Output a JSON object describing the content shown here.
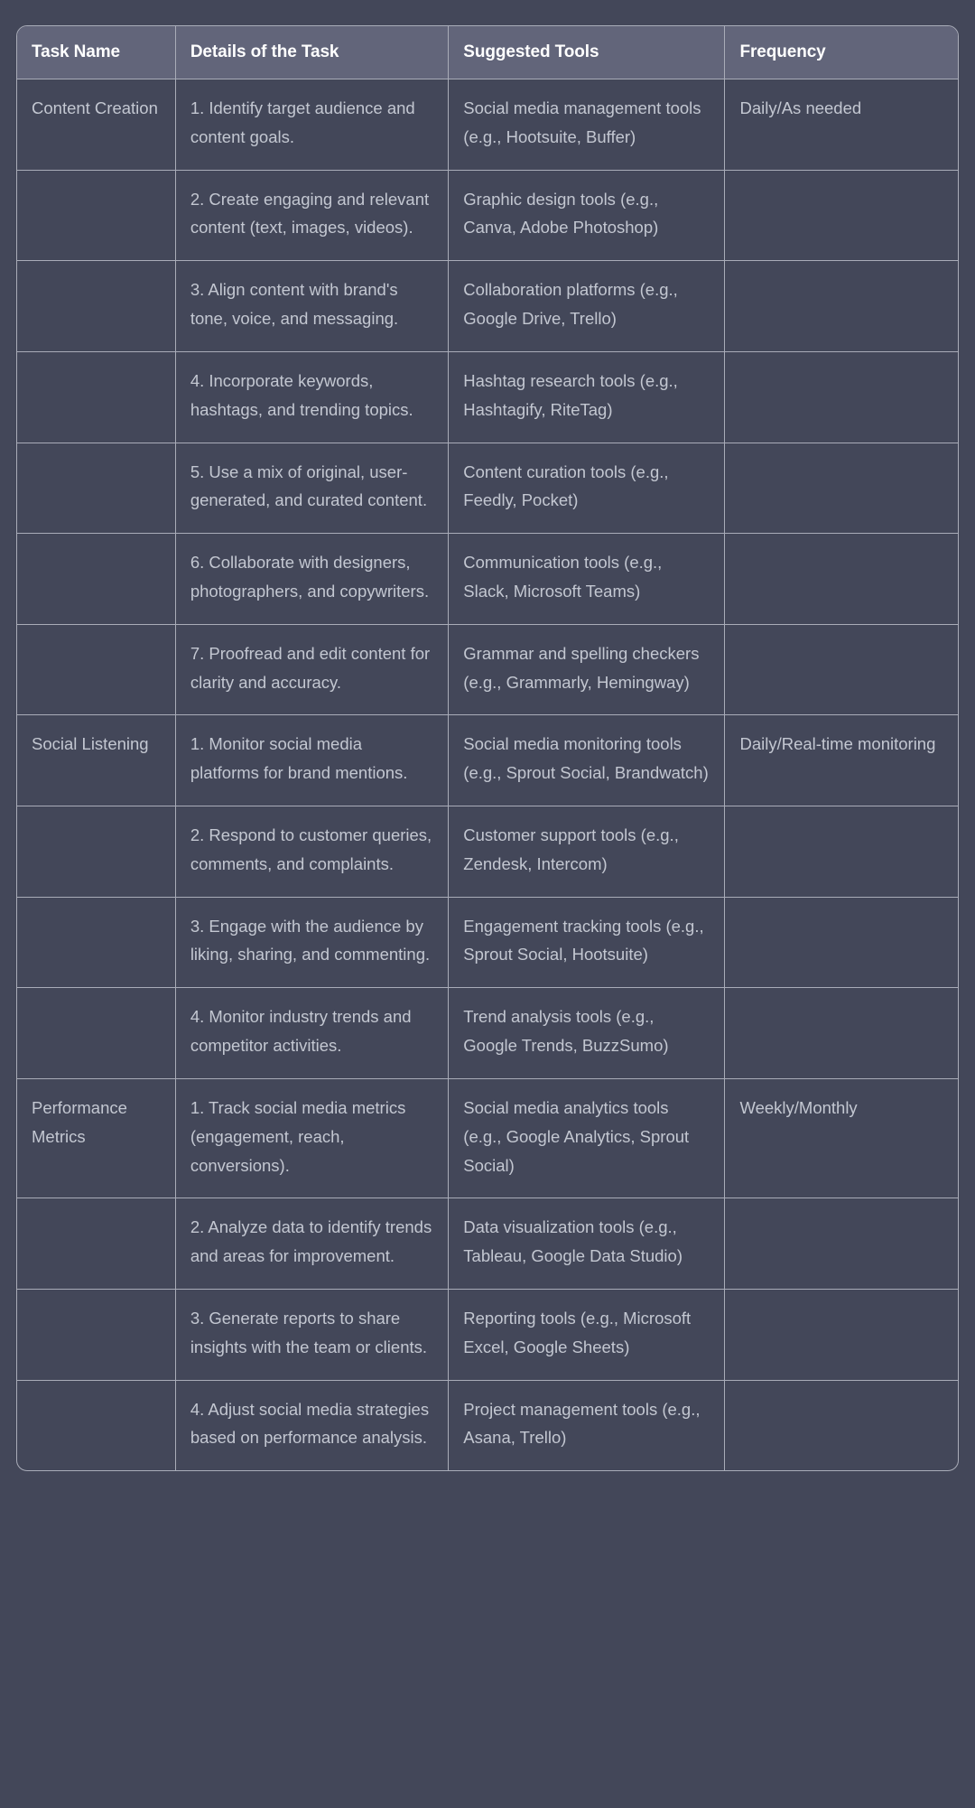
{
  "table": {
    "columns": [
      {
        "key": "task",
        "label": "Task Name"
      },
      {
        "key": "details",
        "label": "Details of the Task"
      },
      {
        "key": "tools",
        "label": "Suggested Tools"
      },
      {
        "key": "frequency",
        "label": "Frequency"
      }
    ],
    "rows": [
      {
        "task": "Content Creation",
        "details": "1. Identify target audience and content goals.",
        "tools": "Social media management tools (e.g., Hootsuite, Buffer)",
        "frequency": "Daily/As needed"
      },
      {
        "task": "",
        "details": "2. Create engaging and relevant content (text, images, videos).",
        "tools": "Graphic design tools (e.g., Canva, Adobe Photoshop)",
        "frequency": ""
      },
      {
        "task": "",
        "details": "3. Align content with brand's tone, voice, and messaging.",
        "tools": "Collaboration platforms (e.g., Google Drive, Trello)",
        "frequency": ""
      },
      {
        "task": "",
        "details": "4. Incorporate keywords, hashtags, and trending topics.",
        "tools": "Hashtag research tools (e.g., Hashtagify, RiteTag)",
        "frequency": ""
      },
      {
        "task": "",
        "details": "5. Use a mix of original, user-generated, and curated content.",
        "tools": "Content curation tools (e.g., Feedly, Pocket)",
        "frequency": ""
      },
      {
        "task": "",
        "details": "6. Collaborate with designers, photographers, and copywriters.",
        "tools": "Communication tools (e.g., Slack, Microsoft Teams)",
        "frequency": ""
      },
      {
        "task": "",
        "details": "7. Proofread and edit content for clarity and accuracy.",
        "tools": "Grammar and spelling checkers (e.g., Grammarly, Hemingway)",
        "frequency": ""
      },
      {
        "task": "Social Listening",
        "details": "1. Monitor social media platforms for brand mentions.",
        "tools": "Social media monitoring tools (e.g., Sprout Social, Brandwatch)",
        "frequency": "Daily/Real-time monitoring"
      },
      {
        "task": "",
        "details": "2. Respond to customer queries, comments, and complaints.",
        "tools": "Customer support tools (e.g., Zendesk, Intercom)",
        "frequency": ""
      },
      {
        "task": "",
        "details": "3. Engage with the audience by liking, sharing, and commenting.",
        "tools": "Engagement tracking tools (e.g., Sprout Social, Hootsuite)",
        "frequency": ""
      },
      {
        "task": "",
        "details": "4. Monitor industry trends and competitor activities.",
        "tools": "Trend analysis tools (e.g., Google Trends, BuzzSumo)",
        "frequency": ""
      },
      {
        "task": "Performance Metrics",
        "details": "1. Track social media metrics (engagement, reach, conversions).",
        "tools": "Social media analytics tools (e.g., Google Analytics, Sprout Social)",
        "frequency": "Weekly/Monthly"
      },
      {
        "task": "",
        "details": "2. Analyze data to identify trends and areas for improvement.",
        "tools": "Data visualization tools (e.g., Tableau, Google Data Studio)",
        "frequency": ""
      },
      {
        "task": "",
        "details": "3. Generate reports to share insights with the team or clients.",
        "tools": "Reporting tools (e.g., Microsoft Excel, Google Sheets)",
        "frequency": ""
      },
      {
        "task": "",
        "details": "4. Adjust social media strategies based on performance analysis.",
        "tools": "Project management tools (e.g., Asana, Trello)",
        "frequency": ""
      }
    ]
  },
  "colors": {
    "page_background": "#434759",
    "header_background": "#62657a",
    "border": "#a9acb8",
    "header_text": "#ffffff",
    "body_text": "#c3c7d1"
  }
}
